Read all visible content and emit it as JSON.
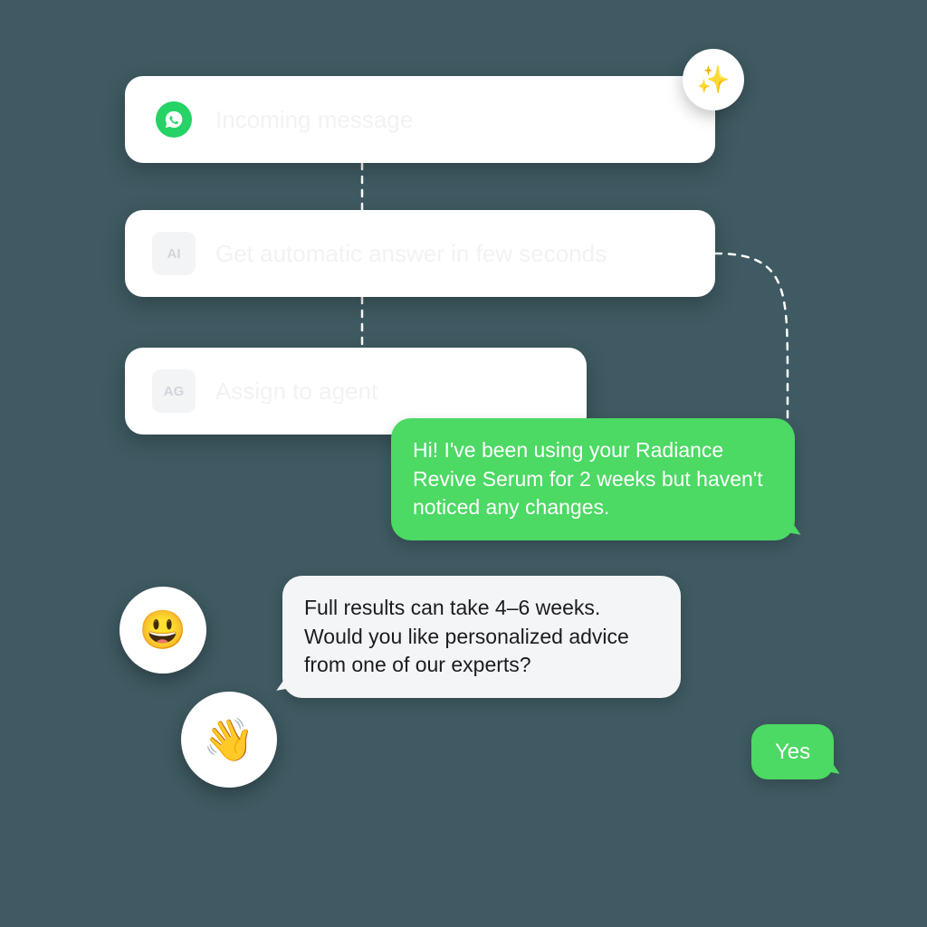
{
  "flow": {
    "card1": {
      "label": "Incoming message"
    },
    "card2": {
      "label": "Get automatic answer in few seconds"
    },
    "card3": {
      "label": "Assign to agent"
    }
  },
  "decor": {
    "sparkle": "✨",
    "smile": "😃",
    "wave": "👋"
  },
  "chat": {
    "user1": "Hi! I've been using your Radiance Revive Serum for 2 weeks but haven't noticed any changes.",
    "agent1": "Full results can take 4–6 weeks. Would you like personalized advice from one of our experts?",
    "user2": "Yes"
  },
  "colors": {
    "bg": "#3f5a62",
    "green": "#4cd964",
    "whatsapp": "#25d366"
  }
}
